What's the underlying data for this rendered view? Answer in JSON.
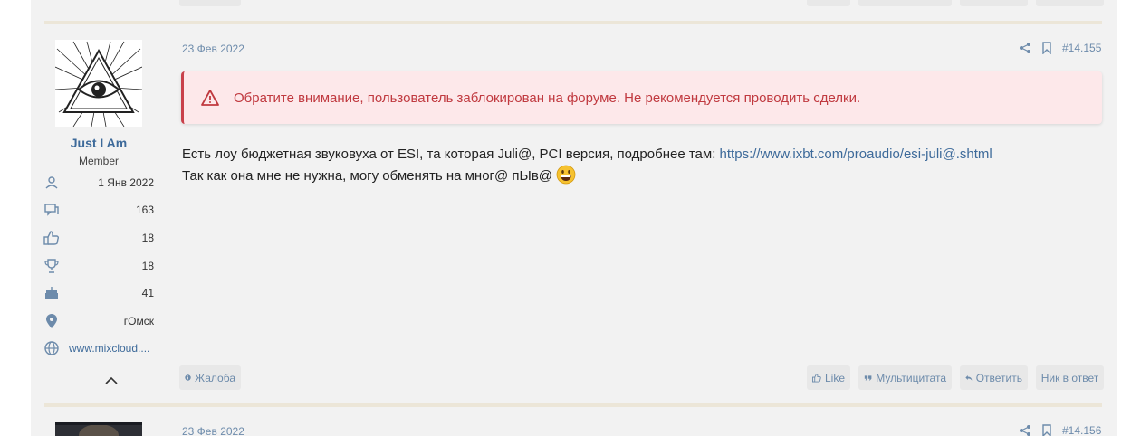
{
  "post": {
    "date": "23 Фев 2022",
    "number": "#14.155",
    "user": {
      "name": "Just I Am",
      "title": "Member",
      "joined": "1 Янв 2022",
      "messages": "163",
      "reactions": "18",
      "points": "18",
      "age": "41",
      "location": "гОмск",
      "website": "www.mixcloud...."
    },
    "warning": "Обратите внимание, пользователь заблокирован на форуме. Не рекомендуется проводить сделки.",
    "body": {
      "line1_prefix": "Есть лоу бюджетная звуковуха от ESI, та которая Juli@, PCI версия, подробнее там: ",
      "link": "https://www.ixbt.com/proaudio/esi-juli@.shtml",
      "line2": "Так как она мне не нужна, могу обменять на мног@ пЫв@"
    },
    "actions": {
      "report": "Жалоба",
      "like": "Like",
      "multiquote": "Мультицитата",
      "reply": "Ответить",
      "nick": "Ник в ответ"
    }
  },
  "next_post": {
    "date": "23 Фев 2022",
    "number": "#14.156"
  },
  "colors": {
    "accent": "#3d6a9a",
    "warning_bg": "#fde8ea",
    "warning_text": "#c0393f",
    "separator": "#ece6d8"
  },
  "icons": {
    "share": "share-icon",
    "bookmark": "bookmark-icon",
    "warning": "warning-triangle-icon",
    "emoji": "grinning-face-emoji"
  }
}
